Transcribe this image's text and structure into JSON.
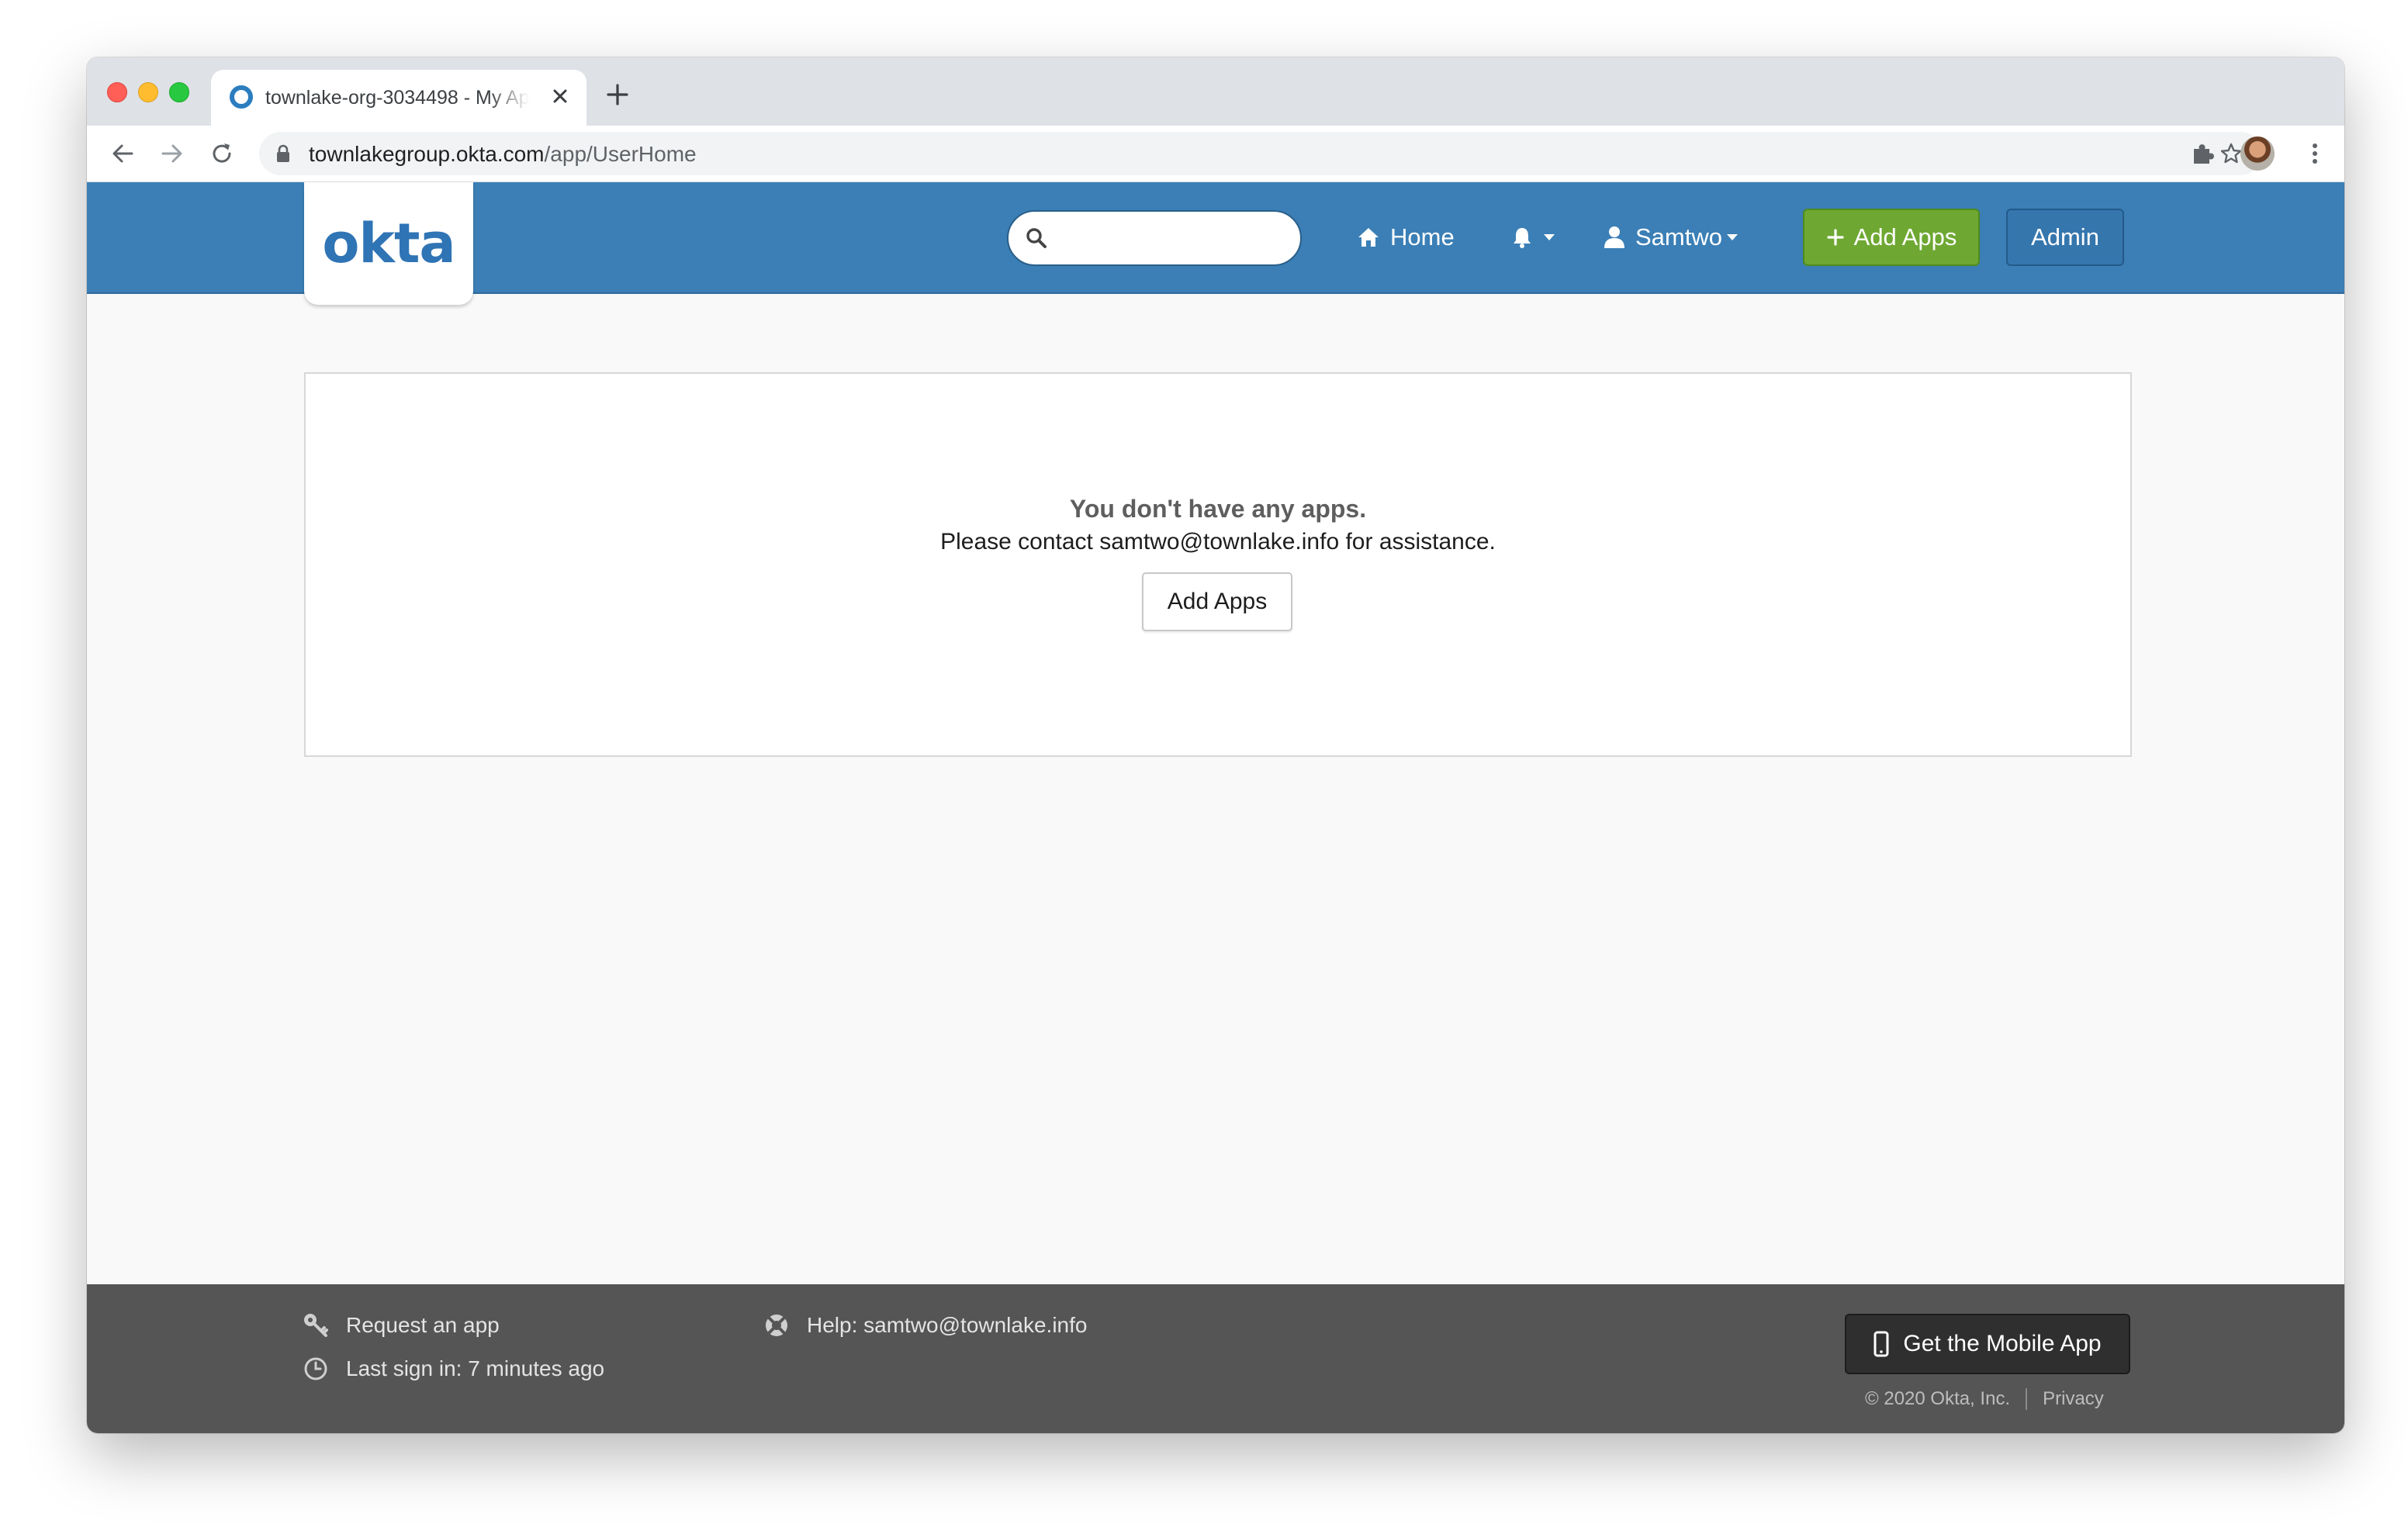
{
  "browser": {
    "tab_title": "townlake-org-3034498 - My Apps",
    "url_host": "townlakegroup.okta.com",
    "url_path": "/app/UserHome"
  },
  "header": {
    "logo_text": "okta",
    "search_placeholder": "",
    "nav_home": "Home",
    "nav_user": "Samtwo",
    "add_apps_label": "Add Apps",
    "admin_label": "Admin",
    "brand_color": "#3b7fb6",
    "add_apps_color": "#6ea832"
  },
  "main": {
    "empty_title": "You don't have any apps.",
    "empty_message": "Please contact samtwo@townlake.info for assistance.",
    "add_apps_button": "Add Apps"
  },
  "footer": {
    "request_app": "Request an app",
    "last_sign_in": "Last sign in: 7 minutes ago",
    "help": "Help: samtwo@townlake.info",
    "mobile_app_button": "Get the Mobile App",
    "copyright": "© 2020 Okta, Inc.",
    "privacy": "Privacy"
  },
  "icons": [
    "search-icon",
    "home-icon",
    "bell-icon",
    "user-icon",
    "plus-icon",
    "key-icon",
    "clock-icon",
    "help-lifebuoy-icon",
    "phone-icon"
  ]
}
